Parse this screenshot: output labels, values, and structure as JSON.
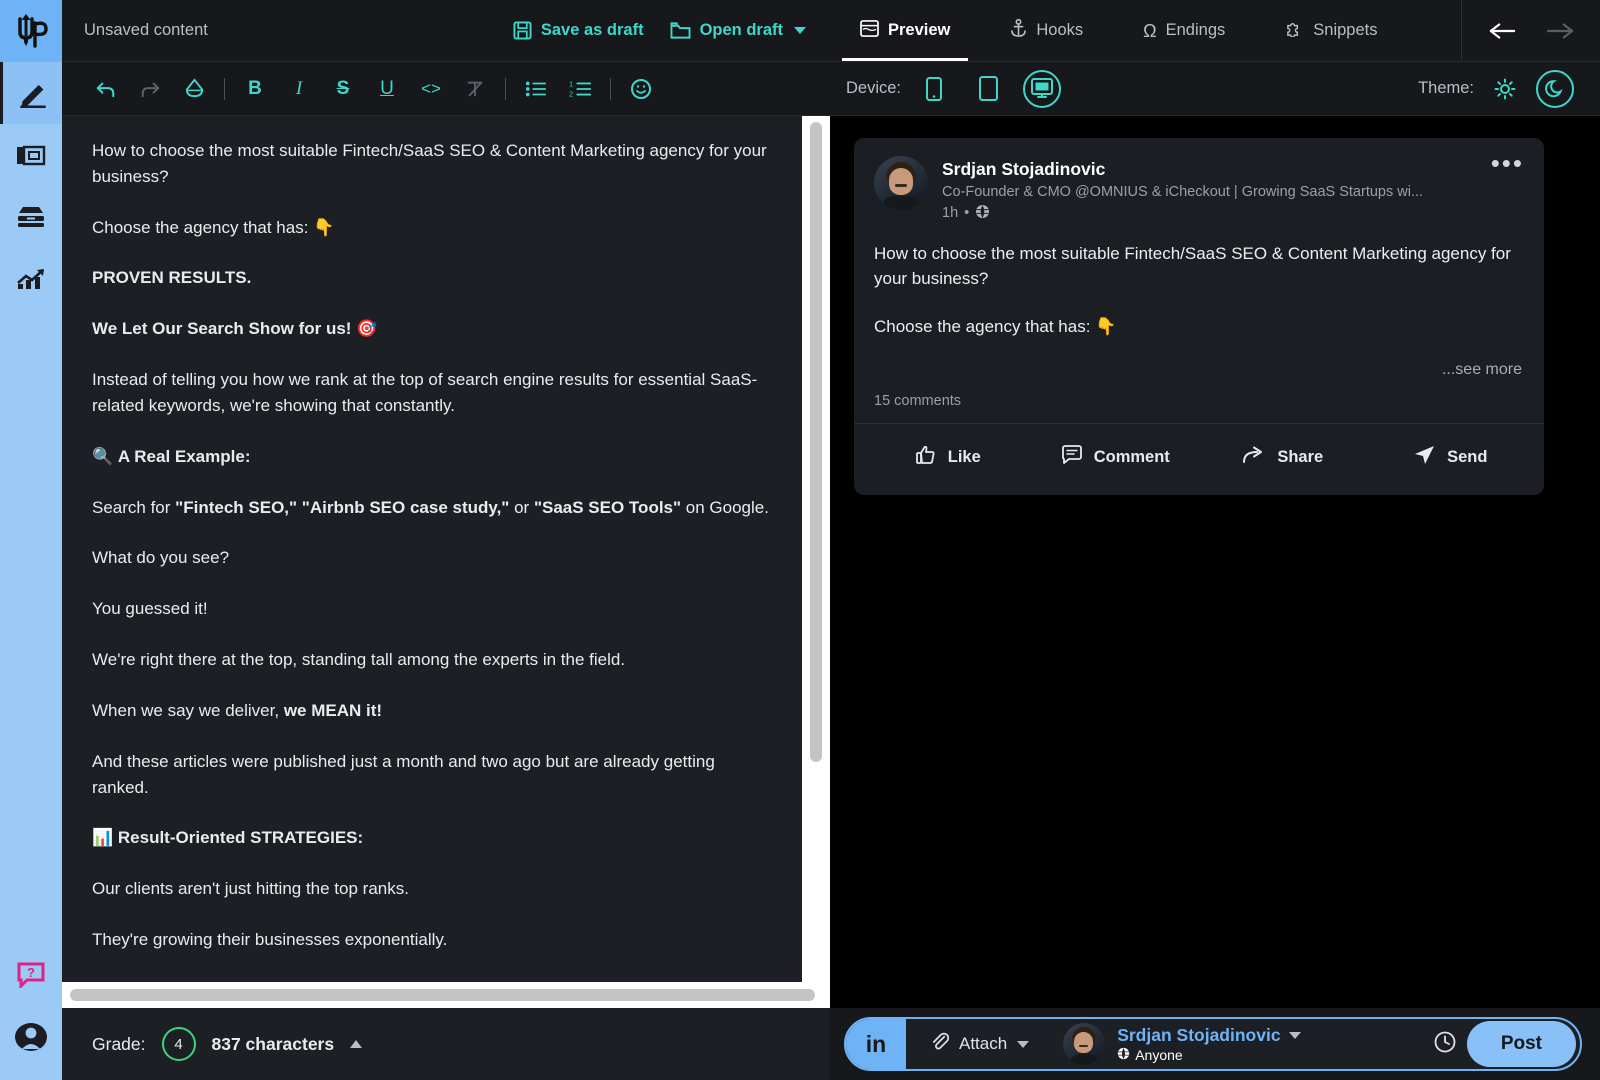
{
  "app": {
    "logo_text": "Up"
  },
  "sidebar": {
    "items": [
      {
        "name": "write",
        "icon": "pen-icon",
        "active": true
      },
      {
        "name": "templates",
        "icon": "template-icon",
        "active": false
      },
      {
        "name": "inbox",
        "icon": "inbox-icon",
        "active": false
      },
      {
        "name": "analytics",
        "icon": "analytics-icon",
        "active": false
      }
    ],
    "bottom": [
      {
        "name": "help",
        "icon": "help-bubble-icon"
      },
      {
        "name": "account",
        "icon": "user-avatar-icon"
      }
    ],
    "colors": {
      "bg": "#9ccaf7",
      "logo_bg": "#6eb3f5",
      "help": "#e0218a"
    }
  },
  "editor": {
    "title": "Unsaved content",
    "save_draft_label": "Save as draft",
    "open_draft_label": "Open draft",
    "toolbar": [
      {
        "name": "undo",
        "glyph": "↶",
        "muted": false
      },
      {
        "name": "redo",
        "glyph": "↷",
        "muted": true
      },
      {
        "name": "eraser",
        "glyph": "◇",
        "muted": false
      },
      {
        "name": "separator",
        "glyph": "",
        "muted": false
      },
      {
        "name": "bold",
        "glyph": "B",
        "muted": false
      },
      {
        "name": "italic",
        "glyph": "I",
        "muted": false
      },
      {
        "name": "strikethrough",
        "glyph": "S",
        "muted": false
      },
      {
        "name": "underline",
        "glyph": "U",
        "muted": false
      },
      {
        "name": "code",
        "glyph": "<>",
        "muted": false
      },
      {
        "name": "clear-format",
        "glyph": "T̸",
        "muted": true
      },
      {
        "name": "separator",
        "glyph": "",
        "muted": false
      },
      {
        "name": "bullet-list",
        "glyph": "☰",
        "muted": false
      },
      {
        "name": "numbered-list",
        "glyph": "≣",
        "muted": false
      },
      {
        "name": "separator",
        "glyph": "",
        "muted": false
      },
      {
        "name": "emoji",
        "glyph": "☺",
        "muted": false
      }
    ],
    "paragraphs": [
      {
        "html": "How to choose the most suitable Fintech/SaaS SEO &amp; Content Marketing agency for your business?"
      },
      {
        "html": "Choose the agency that has: 👇"
      },
      {
        "html": "<b>PROVEN RESULTS.</b>"
      },
      {
        "html": "<b>We Let Our Search Show for us!</b> 🎯"
      },
      {
        "html": "Instead of telling you how we rank at the top of search engine results for essential SaaS-related keywords, we're showing that constantly."
      },
      {
        "html": "🔍 <b>A Real Example:</b>"
      },
      {
        "html": "Search for <b>\"Fintech SEO,\" \"Airbnb SEO case study,\"</b> or <b>\"SaaS SEO Tools\"</b> on Google."
      },
      {
        "html": "What do you see?"
      },
      {
        "html": "You guessed it!"
      },
      {
        "html": "We're right there at the top, standing tall among the experts in the field."
      },
      {
        "html": "When we say we deliver, <b>we MEAN it!</b>"
      },
      {
        "html": "And these articles were published just a month and two ago but are already getting ranked."
      },
      {
        "html": "📊 <b>Result-Oriented STRATEGIES:</b>"
      },
      {
        "html": "Our clients aren't just hitting the top ranks."
      },
      {
        "html": "They're growing their businesses exponentially."
      }
    ]
  },
  "status": {
    "grade_label": "Grade:",
    "grade_value": "4",
    "grade_color": "#3ed37f",
    "char_count": "837 characters"
  },
  "preview": {
    "tabs": [
      {
        "label": "Preview",
        "icon": "browser-window-icon",
        "active": true
      },
      {
        "label": "Hooks",
        "icon": "anchor-icon",
        "active": false
      },
      {
        "label": "Endings",
        "icon": "omega-icon",
        "active": false
      },
      {
        "label": "Snippets",
        "icon": "puzzle-piece-icon",
        "active": false
      }
    ],
    "nav": {
      "back": "back-arrow-icon",
      "forward": "forward-arrow-icon"
    },
    "device_label": "Device:",
    "devices": [
      {
        "name": "phone",
        "selected": false
      },
      {
        "name": "tablet",
        "selected": false
      },
      {
        "name": "desktop",
        "selected": true
      }
    ],
    "theme_label": "Theme:",
    "themes": [
      {
        "name": "light",
        "icon": "sun-icon",
        "selected": false
      },
      {
        "name": "dark",
        "icon": "moon-icon",
        "selected": true
      }
    ],
    "accent": "#3fd7c9"
  },
  "post": {
    "author": "Srdjan Stojadinovic",
    "headline": "Co-Founder & CMO @OMNIUS & iCheckout | Growing SaaS Startups wi...",
    "time": "1h",
    "visibility_icon": "globe-icon",
    "menu_icon": "more-options-icon",
    "body": [
      "How to choose the most suitable Fintech/SaaS SEO & Content Marketing agency for your business?",
      "Choose the agency that has: 👇"
    ],
    "see_more": "...see more",
    "comments": "15 comments",
    "actions": [
      {
        "label": "Like",
        "icon": "thumbs-up-icon"
      },
      {
        "label": "Comment",
        "icon": "comment-bubble-icon"
      },
      {
        "label": "Share",
        "icon": "share-arrow-icon"
      },
      {
        "label": "Send",
        "icon": "send-paper-plane-icon"
      }
    ]
  },
  "compose": {
    "network_badge": "in",
    "attach_label": "Attach",
    "user_name": "Srdjan Stojadinovic",
    "audience": "Anyone",
    "schedule_icon": "clock-icon",
    "post_label": "Post",
    "accent": "#6eb3f5"
  }
}
